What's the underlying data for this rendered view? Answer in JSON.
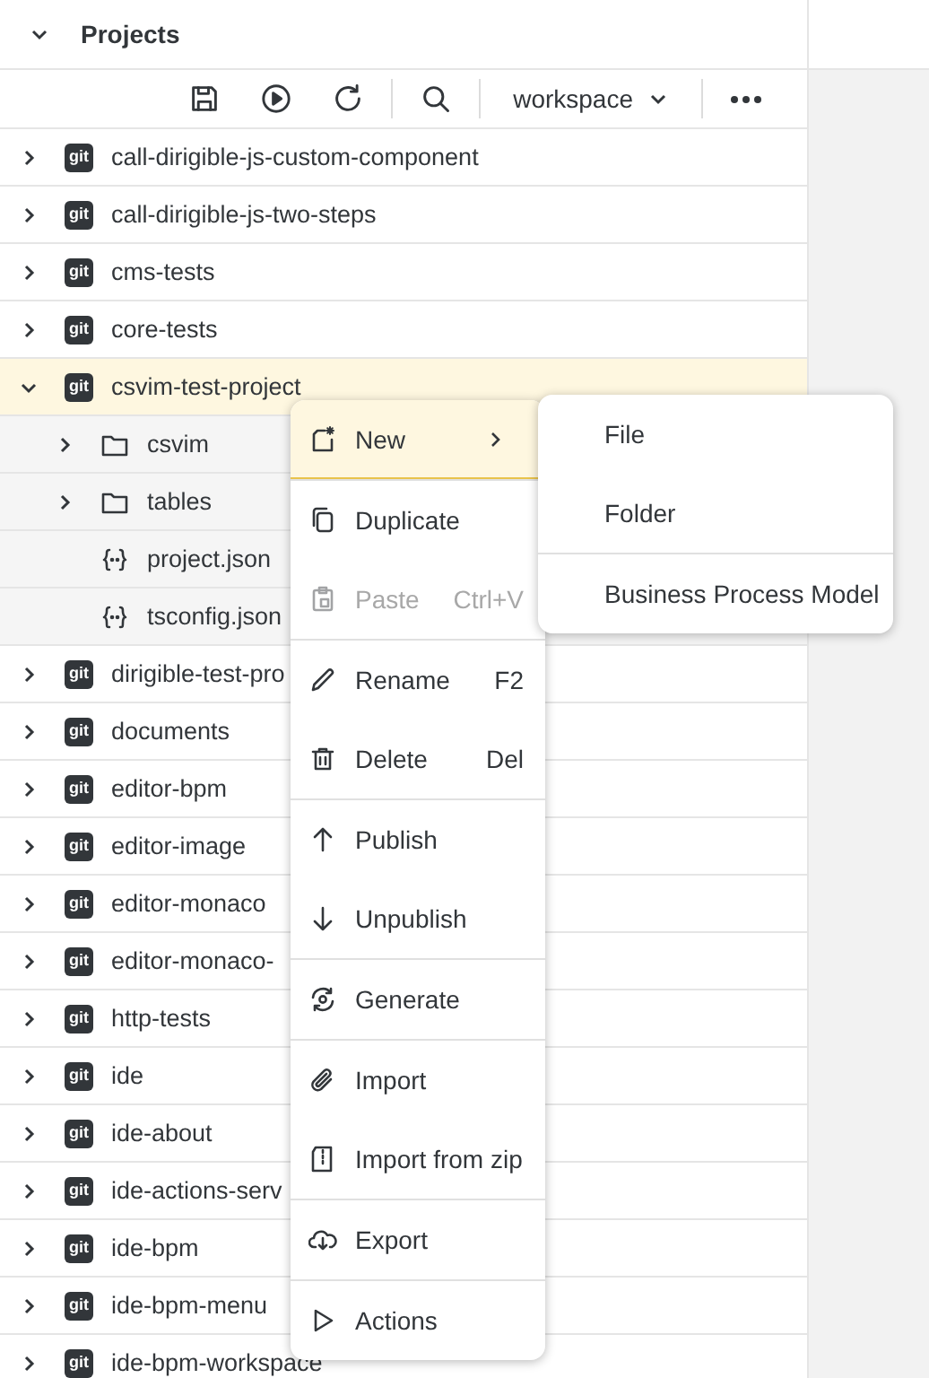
{
  "panel": {
    "title": "Projects",
    "expanded": true
  },
  "toolbar": {
    "workspace": "workspace"
  },
  "tree": [
    {
      "label": "call-dirigible-js-custom-component",
      "kind": "git",
      "badge": "git",
      "expanded": false,
      "selected": false
    },
    {
      "label": "call-dirigible-js-two-steps",
      "kind": "git",
      "badge": "git",
      "expanded": false,
      "selected": false
    },
    {
      "label": "cms-tests",
      "kind": "git",
      "badge": "git",
      "expanded": false,
      "selected": false
    },
    {
      "label": "core-tests",
      "kind": "git",
      "badge": "git",
      "expanded": false,
      "selected": false
    },
    {
      "label": "csvim-test-project",
      "kind": "git",
      "badge": "git",
      "expanded": true,
      "selected": true,
      "children": [
        {
          "label": "csvim",
          "kind": "folder",
          "expanded": false,
          "selected": false
        },
        {
          "label": "tables",
          "kind": "folder",
          "expanded": false,
          "selected": false
        },
        {
          "label": "project.json",
          "kind": "file",
          "selected": false
        },
        {
          "label": "tsconfig.json",
          "kind": "file",
          "selected": false
        }
      ]
    },
    {
      "label": "dirigible-test-pro",
      "kind": "git",
      "badge": "git",
      "expanded": false,
      "selected": false
    },
    {
      "label": "documents",
      "kind": "git",
      "badge": "git",
      "expanded": false,
      "selected": false
    },
    {
      "label": "editor-bpm",
      "kind": "git",
      "badge": "git",
      "expanded": false,
      "selected": false
    },
    {
      "label": "editor-image",
      "kind": "git",
      "badge": "git",
      "expanded": false,
      "selected": false
    },
    {
      "label": "editor-monaco",
      "kind": "git",
      "badge": "git",
      "expanded": false,
      "selected": false
    },
    {
      "label": "editor-monaco-",
      "kind": "git",
      "badge": "git",
      "expanded": false,
      "selected": false
    },
    {
      "label": "http-tests",
      "kind": "git",
      "badge": "git",
      "expanded": false,
      "selected": false
    },
    {
      "label": "ide",
      "kind": "git",
      "badge": "git",
      "expanded": false,
      "selected": false
    },
    {
      "label": "ide-about",
      "kind": "git",
      "badge": "git",
      "expanded": false,
      "selected": false
    },
    {
      "label": "ide-actions-serv",
      "kind": "git",
      "badge": "git",
      "expanded": false,
      "selected": false
    },
    {
      "label": "ide-bpm",
      "kind": "git",
      "badge": "git",
      "expanded": false,
      "selected": false
    },
    {
      "label": "ide-bpm-menu",
      "kind": "git",
      "badge": "git",
      "expanded": false,
      "selected": false
    },
    {
      "label": "ide-bpm-workspace",
      "kind": "git",
      "badge": "git",
      "expanded": false,
      "selected": false
    }
  ],
  "context_menu": {
    "groups": [
      [
        {
          "label": "New",
          "selected": true,
          "submenu": true
        }
      ],
      [
        {
          "label": "Duplicate",
          "selected": false
        },
        {
          "label": "Paste",
          "shortcut": "Ctrl+V",
          "selected": false,
          "disabled": true
        }
      ],
      [
        {
          "label": "Rename",
          "shortcut": "F2",
          "selected": false
        },
        {
          "label": "Delete",
          "shortcut": "Del",
          "selected": false
        }
      ],
      [
        {
          "label": "Publish",
          "selected": false
        },
        {
          "label": "Unpublish",
          "selected": false
        }
      ],
      [
        {
          "label": "Generate",
          "selected": false
        }
      ],
      [
        {
          "label": "Import",
          "selected": false
        },
        {
          "label": "Import from zip",
          "selected": false
        }
      ],
      [
        {
          "label": "Export",
          "selected": false
        }
      ],
      [
        {
          "label": "Actions",
          "selected": false
        }
      ]
    ]
  },
  "submenu": {
    "groups": [
      [
        {
          "label": "File"
        },
        {
          "label": "Folder"
        }
      ],
      [
        {
          "label": "Business Process Model"
        }
      ]
    ]
  }
}
